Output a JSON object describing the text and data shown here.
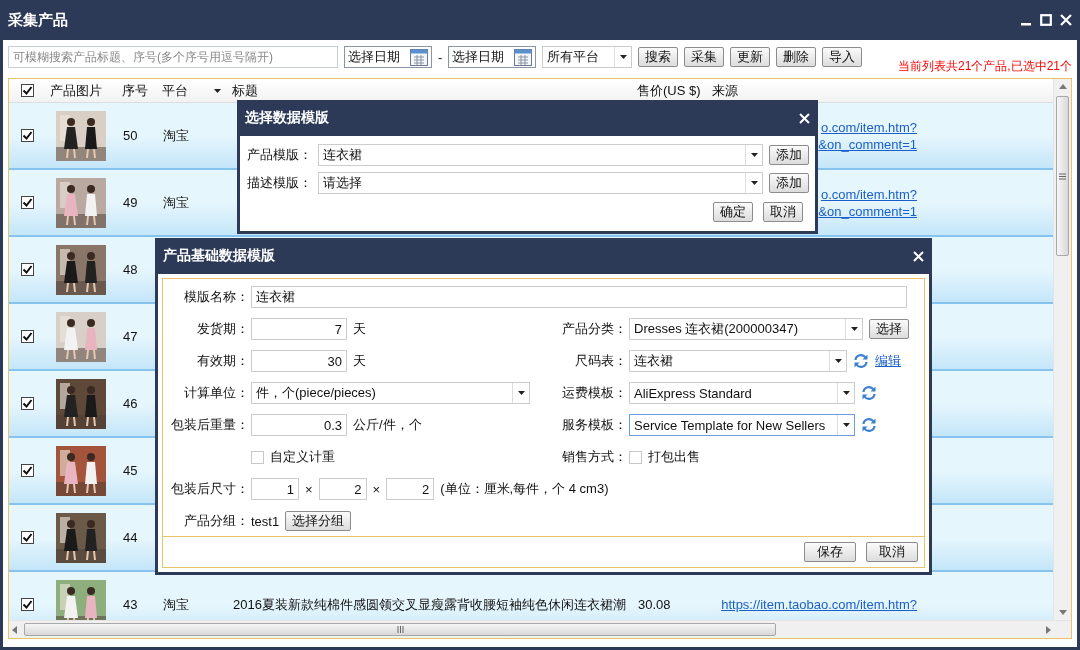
{
  "window": {
    "title": "采集产品"
  },
  "toolbar": {
    "search": {
      "placeholder": "可模糊搜索产品标题、序号(多个序号用逗号隔开)"
    },
    "date_from": {
      "placeholder": "选择日期"
    },
    "date_separator": "-",
    "date_to": {
      "placeholder": "选择日期"
    },
    "platform": {
      "value": "所有平台"
    },
    "buttons": [
      "搜索",
      "采集",
      "更新",
      "删除",
      "导入"
    ],
    "status": "当前列表共21个产品,已选中21个"
  },
  "table": {
    "select_all": {
      "checked": true
    },
    "columns": [
      "产品图片",
      "序号",
      "平台",
      "标题",
      "售价(US $)",
      "来源"
    ],
    "rows": [
      {
        "checked": true,
        "number": "50",
        "platform": "淘宝",
        "source_lines": [
          "o.com/item.htm?",
          "&on_comment=1"
        ]
      },
      {
        "checked": true,
        "number": "49",
        "platform": "淘宝",
        "source_lines": [
          "o.com/item.htm?",
          "&on_comment=1"
        ]
      },
      {
        "checked": true,
        "number": "48"
      },
      {
        "checked": true,
        "number": "47"
      },
      {
        "checked": true,
        "number": "46"
      },
      {
        "checked": true,
        "number": "45"
      },
      {
        "checked": true,
        "number": "44"
      },
      {
        "checked": true,
        "number": "43",
        "platform": "淘宝",
        "title": "2016夏装新款纯棉件感圆领交叉显瘦露背收腰短袖纯色休闲连衣裙潮",
        "price": "30.08",
        "source_lines": [
          "https://item.taobao.com/item.htm?"
        ]
      }
    ]
  },
  "template_dialog": {
    "title": "选择数据模版",
    "fields": [
      {
        "label": "产品模版：",
        "value": "连衣裙",
        "button": "添加"
      },
      {
        "label": "描述模版：",
        "value": "请选择",
        "button": "添加"
      }
    ],
    "buttons": [
      "确定",
      "取消"
    ]
  },
  "base_dialog": {
    "title": "产品基础数据模版",
    "name": {
      "label": "模版名称：",
      "value": "连衣裙"
    },
    "left": [
      {
        "kind": "number",
        "label": "发货期：",
        "value": "7",
        "unit": "天"
      },
      {
        "kind": "number",
        "label": "有效期：",
        "value": "30",
        "unit": "天"
      },
      {
        "kind": "select",
        "label": "计算单位：",
        "value": "件，个(piece/pieces)",
        "focused": false
      },
      {
        "kind": "number",
        "label": "包装后重量：",
        "value": "0.3",
        "unit": "公斤/件，个"
      },
      {
        "kind": "checkbox",
        "option": "自定义计重",
        "checked": false
      }
    ],
    "right": [
      {
        "kind": "select",
        "label": "产品分类：",
        "value": "Dresses 连衣裙(200000347)",
        "button": "选择",
        "focused": false
      },
      {
        "kind": "select",
        "label": "尺码表：",
        "value": "连衣裙",
        "refresh": true,
        "link": "编辑",
        "focused": false
      },
      {
        "kind": "select",
        "label": "运费模板：",
        "value": "AliExpress Standard",
        "refresh": true,
        "focused": false
      },
      {
        "kind": "select",
        "label": "服务模板：",
        "value": "Service Template for New Sellers",
        "refresh": true,
        "focused": true
      },
      {
        "kind": "checkbox",
        "label": "销售方式：",
        "option": "打包出售",
        "checked": false
      }
    ],
    "size": {
      "label": "包装后尺寸：",
      "values": [
        "1",
        "2",
        "2"
      ],
      "separators": [
        "×",
        "×"
      ],
      "note": "(单位：厘米,每件，个  4 cm3)"
    },
    "group": {
      "label": "产品分组：",
      "value": "test1",
      "button": "选择分组"
    },
    "buttons": [
      "保存",
      "取消"
    ]
  }
}
